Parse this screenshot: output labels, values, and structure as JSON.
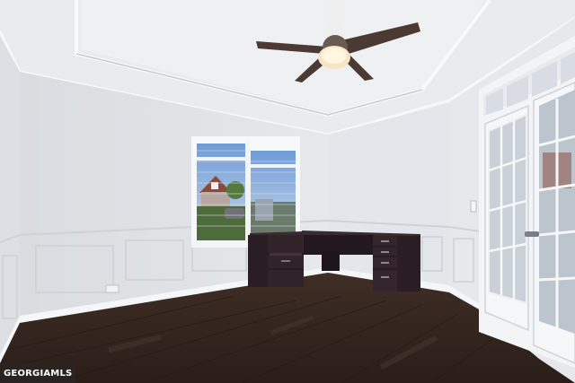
{
  "scene": {
    "description_colors": {
      "wall": "#e8eaed",
      "ceiling": "#eef0f2",
      "floor": "#3a2a22",
      "desk": "#2c1f25",
      "door_frame": "#f4f5f7",
      "fan_blade": "#4a3a33"
    }
  },
  "watermark": {
    "text": "GEORGIAMLS"
  }
}
